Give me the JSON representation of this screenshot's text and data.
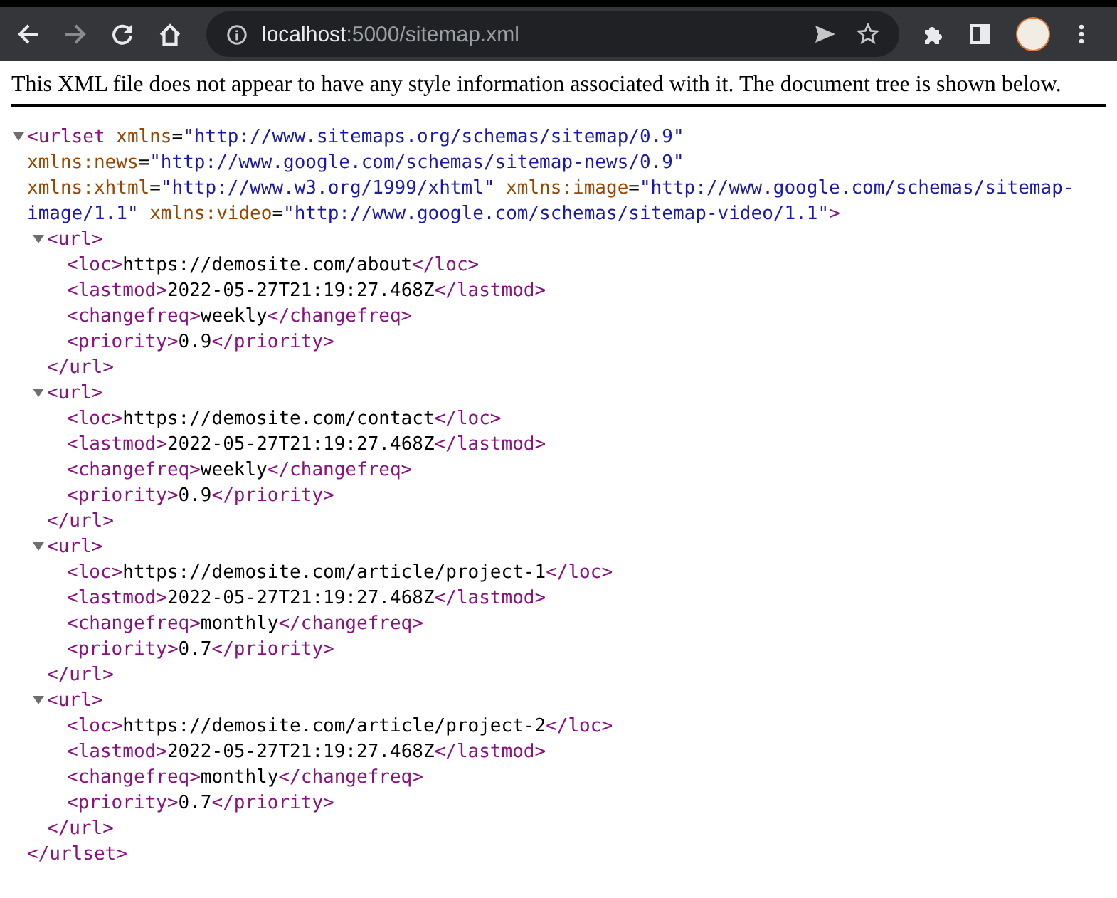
{
  "browser": {
    "back_enabled": true,
    "forward_enabled": false,
    "url": {
      "host": "localhost",
      "rest": ":5000/sitemap.xml"
    }
  },
  "notice": "This XML file does not appear to have any style information associated with it. The document tree is shown below.",
  "tree": {
    "expanded": true,
    "open": [
      {
        "kind": "tag",
        "text": "<urlset"
      },
      {
        "kind": "name",
        "text": " xmlns"
      },
      {
        "kind": "plain",
        "text": "="
      },
      {
        "kind": "value",
        "text": "\"http://www.sitemaps.org/schemas/sitemap/0.9\""
      },
      {
        "kind": "name",
        "text": " xmlns:news"
      },
      {
        "kind": "plain",
        "text": "="
      },
      {
        "kind": "value",
        "text": "\"http://www.google.com/schemas/sitemap-news/0.9\""
      },
      {
        "kind": "name",
        "text": " xmlns:xhtml"
      },
      {
        "kind": "plain",
        "text": "="
      },
      {
        "kind": "value",
        "text": "\"http://www.w3.org/1999/xhtml\""
      },
      {
        "kind": "name",
        "text": " xmlns:image"
      },
      {
        "kind": "plain",
        "text": "="
      },
      {
        "kind": "value",
        "text": "\"http://www.google.com/schemas/sitemap-image/1.1\""
      },
      {
        "kind": "name",
        "text": " xmlns:video"
      },
      {
        "kind": "plain",
        "text": "="
      },
      {
        "kind": "value",
        "text": "\"http://www.google.com/schemas/sitemap-video/1.1\""
      },
      {
        "kind": "tag",
        "text": ">"
      }
    ],
    "children": [
      {
        "expanded": true,
        "open": [
          {
            "kind": "tag",
            "text": "<url>"
          }
        ],
        "children": [
          [
            {
              "kind": "tag",
              "text": "<loc>"
            },
            {
              "kind": "plain",
              "text": "https://demosite.com/about"
            },
            {
              "kind": "tag",
              "text": "</loc>"
            }
          ],
          [
            {
              "kind": "tag",
              "text": "<lastmod>"
            },
            {
              "kind": "plain",
              "text": "2022-05-27T21:19:27.468Z"
            },
            {
              "kind": "tag",
              "text": "</lastmod>"
            }
          ],
          [
            {
              "kind": "tag",
              "text": "<changefreq>"
            },
            {
              "kind": "plain",
              "text": "weekly"
            },
            {
              "kind": "tag",
              "text": "</changefreq>"
            }
          ],
          [
            {
              "kind": "tag",
              "text": "<priority>"
            },
            {
              "kind": "plain",
              "text": "0.9"
            },
            {
              "kind": "tag",
              "text": "</priority>"
            }
          ]
        ],
        "close": [
          {
            "kind": "tag",
            "text": "</url>"
          }
        ]
      },
      {
        "expanded": true,
        "open": [
          {
            "kind": "tag",
            "text": "<url>"
          }
        ],
        "children": [
          [
            {
              "kind": "tag",
              "text": "<loc>"
            },
            {
              "kind": "plain",
              "text": "https://demosite.com/contact"
            },
            {
              "kind": "tag",
              "text": "</loc>"
            }
          ],
          [
            {
              "kind": "tag",
              "text": "<lastmod>"
            },
            {
              "kind": "plain",
              "text": "2022-05-27T21:19:27.468Z"
            },
            {
              "kind": "tag",
              "text": "</lastmod>"
            }
          ],
          [
            {
              "kind": "tag",
              "text": "<changefreq>"
            },
            {
              "kind": "plain",
              "text": "weekly"
            },
            {
              "kind": "tag",
              "text": "</changefreq>"
            }
          ],
          [
            {
              "kind": "tag",
              "text": "<priority>"
            },
            {
              "kind": "plain",
              "text": "0.9"
            },
            {
              "kind": "tag",
              "text": "</priority>"
            }
          ]
        ],
        "close": [
          {
            "kind": "tag",
            "text": "</url>"
          }
        ]
      },
      {
        "expanded": true,
        "open": [
          {
            "kind": "tag",
            "text": "<url>"
          }
        ],
        "children": [
          [
            {
              "kind": "tag",
              "text": "<loc>"
            },
            {
              "kind": "plain",
              "text": "https://demosite.com/article/project-1"
            },
            {
              "kind": "tag",
              "text": "</loc>"
            }
          ],
          [
            {
              "kind": "tag",
              "text": "<lastmod>"
            },
            {
              "kind": "plain",
              "text": "2022-05-27T21:19:27.468Z"
            },
            {
              "kind": "tag",
              "text": "</lastmod>"
            }
          ],
          [
            {
              "kind": "tag",
              "text": "<changefreq>"
            },
            {
              "kind": "plain",
              "text": "monthly"
            },
            {
              "kind": "tag",
              "text": "</changefreq>"
            }
          ],
          [
            {
              "kind": "tag",
              "text": "<priority>"
            },
            {
              "kind": "plain",
              "text": "0.7"
            },
            {
              "kind": "tag",
              "text": "</priority>"
            }
          ]
        ],
        "close": [
          {
            "kind": "tag",
            "text": "</url>"
          }
        ]
      },
      {
        "expanded": true,
        "open": [
          {
            "kind": "tag",
            "text": "<url>"
          }
        ],
        "children": [
          [
            {
              "kind": "tag",
              "text": "<loc>"
            },
            {
              "kind": "plain",
              "text": "https://demosite.com/article/project-2"
            },
            {
              "kind": "tag",
              "text": "</loc>"
            }
          ],
          [
            {
              "kind": "tag",
              "text": "<lastmod>"
            },
            {
              "kind": "plain",
              "text": "2022-05-27T21:19:27.468Z"
            },
            {
              "kind": "tag",
              "text": "</lastmod>"
            }
          ],
          [
            {
              "kind": "tag",
              "text": "<changefreq>"
            },
            {
              "kind": "plain",
              "text": "monthly"
            },
            {
              "kind": "tag",
              "text": "</changefreq>"
            }
          ],
          [
            {
              "kind": "tag",
              "text": "<priority>"
            },
            {
              "kind": "plain",
              "text": "0.7"
            },
            {
              "kind": "tag",
              "text": "</priority>"
            }
          ]
        ],
        "close": [
          {
            "kind": "tag",
            "text": "</url>"
          }
        ]
      }
    ],
    "close": [
      {
        "kind": "tag",
        "text": "</urlset>"
      }
    ]
  }
}
